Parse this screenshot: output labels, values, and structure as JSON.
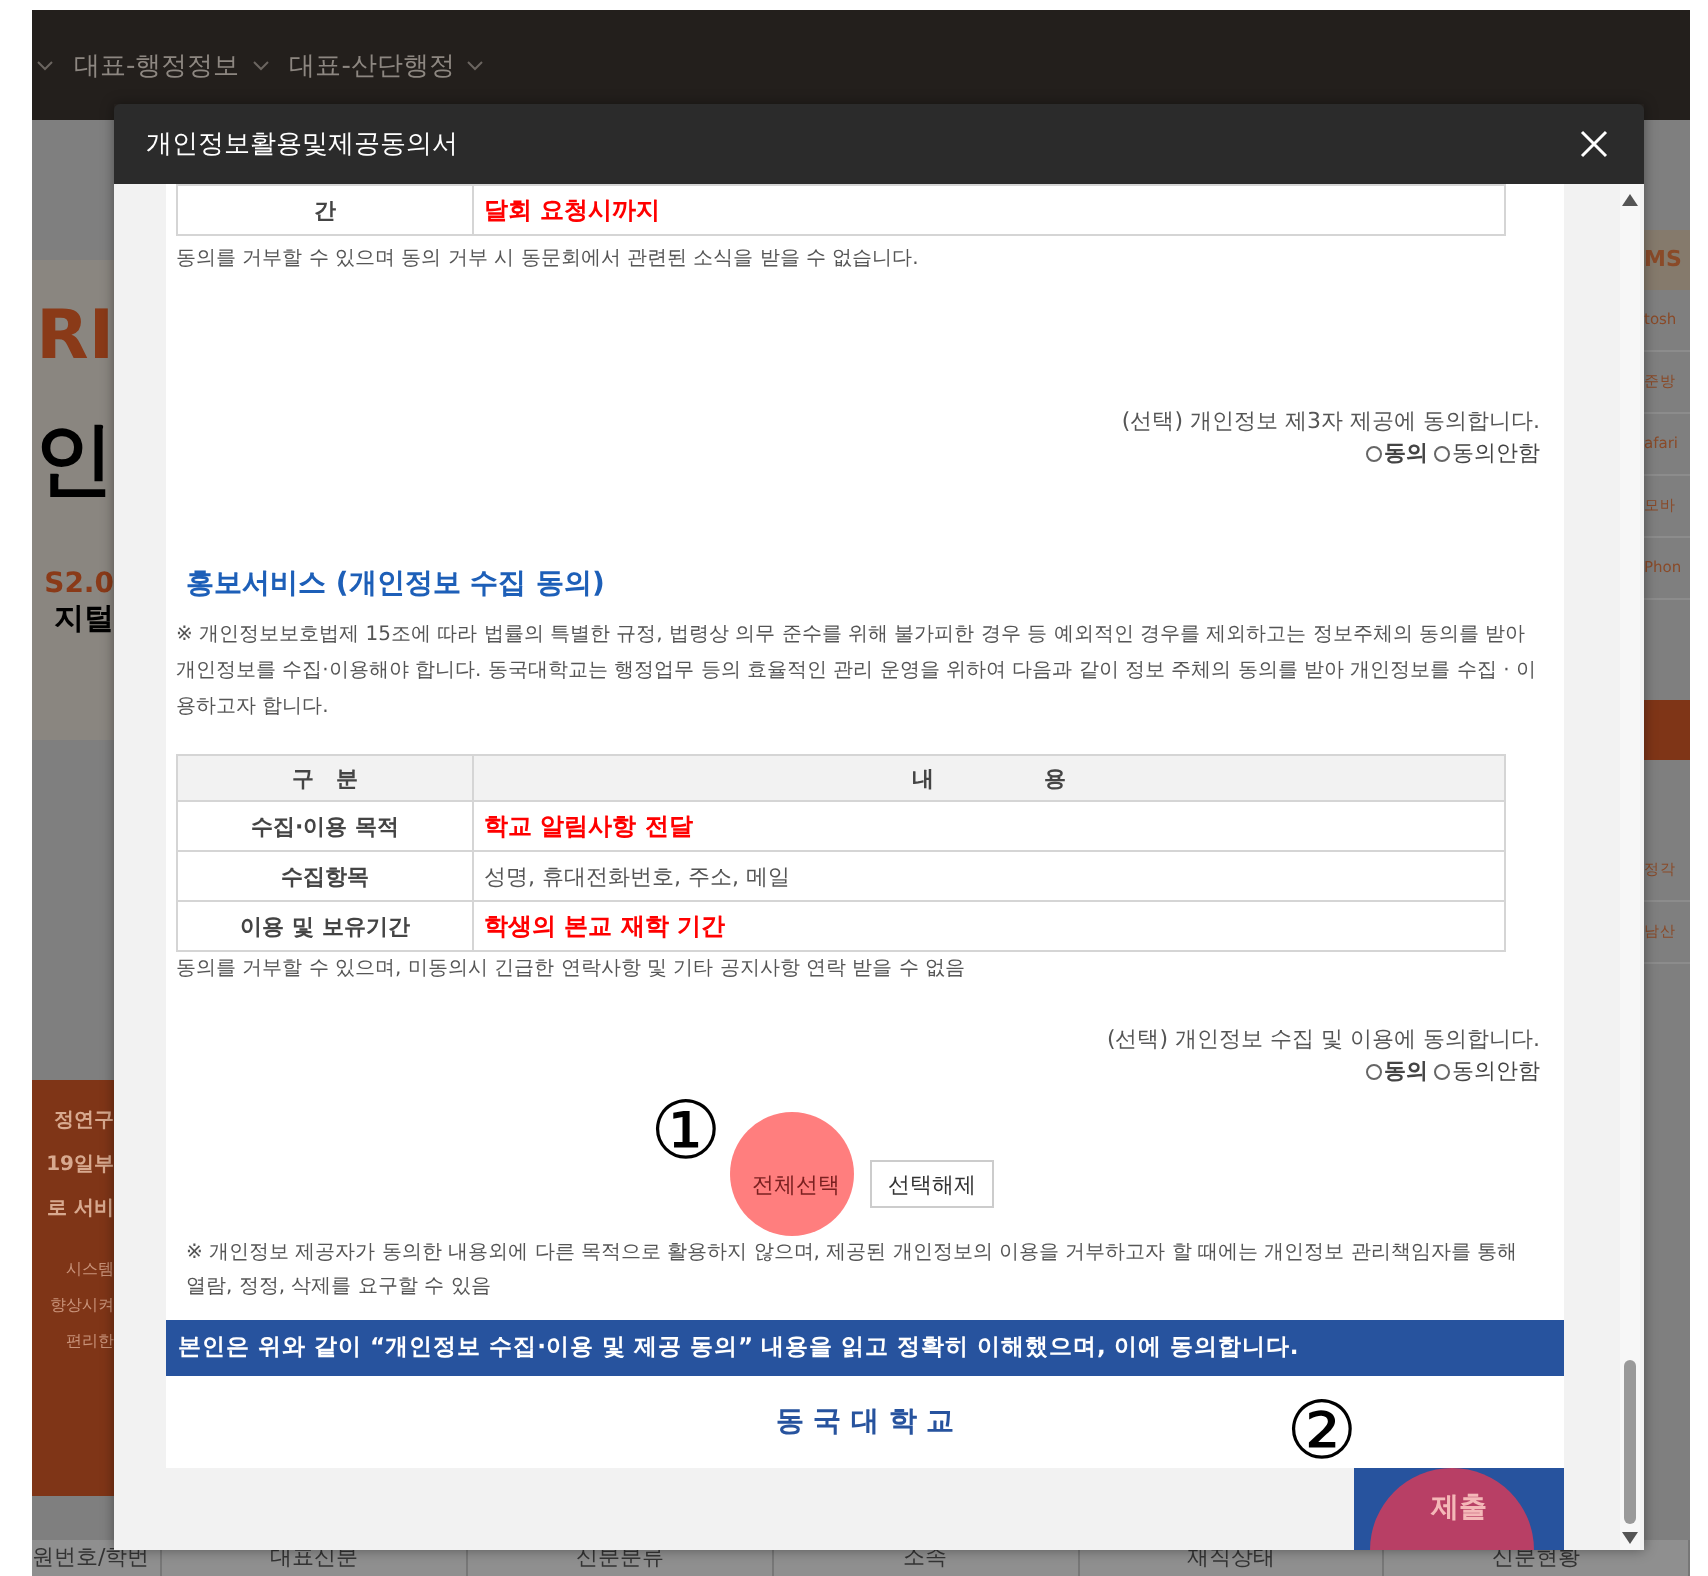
{
  "nav": {
    "items": [
      {
        "label": "대표-행정정보"
      },
      {
        "label": "대표-산단행정"
      }
    ]
  },
  "background": {
    "left": [
      {
        "text": "RI",
        "kind": "accent"
      },
      {
        "text": "인",
        "kind": "title"
      },
      {
        "text": "S2.0",
        "kind": "accent"
      },
      {
        "text": "지털",
        "kind": "strong"
      },
      {
        "text": "정연구",
        "kind": "notice"
      },
      {
        "text": "19일부",
        "kind": "notice"
      },
      {
        "text": "로 서비",
        "kind": "notice"
      },
      {
        "text": "시스템",
        "kind": "small"
      },
      {
        "text": "향상시켜",
        "kind": "small"
      },
      {
        "text": "편리한",
        "kind": "small"
      }
    ],
    "right": [
      {
        "text": "MS",
        "kind": "header"
      },
      {
        "text": "tosh",
        "kind": "row"
      },
      {
        "text": "준방",
        "kind": "row"
      },
      {
        "text": "afari",
        "kind": "row"
      },
      {
        "text": "모바",
        "kind": "row"
      },
      {
        "text": "Phon",
        "kind": "row"
      },
      {
        "kind": "band"
      },
      {
        "text": "정각",
        "kind": "row"
      },
      {
        "text": "남산",
        "kind": "row"
      }
    ],
    "bottom_columns": [
      "원번호/학번",
      "대표신분",
      "신분분류",
      "소속",
      "재직상태",
      "신분현황"
    ]
  },
  "dialog": {
    "title": "개인정보활용및제공동의서",
    "content": [
      {
        "kind": "table",
        "rows": [
          {
            "label": "간",
            "value": "달회 요청시까지",
            "emphasis": true
          }
        ]
      },
      {
        "kind": "note",
        "text": "동의를 거부할 수 있으며 동의 거부 시 동문회에서 관련된 소식을 받을 수 없습니다."
      },
      {
        "kind": "consent",
        "text": "(선택) 개인정보 제3자 제공에 동의합니다.",
        "options": [
          {
            "label": "동의",
            "selected": false
          },
          {
            "label": "동의안함",
            "selected": false
          }
        ]
      },
      {
        "kind": "heading",
        "text": "홍보서비스 (개인정보 수집 동의)"
      },
      {
        "kind": "paragraph",
        "text": "※ 개인정보보호법제 15조에 따라 법률의 특별한 규정, 법령상 의무 준수를 위해 불가피한 경우 등 예외적인 경우를 제외하고는 정보주체의 동의를 받아 개인정보를 수집·이용해야 합니다. 동국대학교는 행정업무 등의 효율적인 관리 운영을 위하여 다음과 같이 정보 주체의 동의를 받아 개인정보를 수집 · 이용하고자 합니다."
      },
      {
        "kind": "table",
        "columns": [
          "구　분",
          "내　　　　　용"
        ],
        "rows": [
          {
            "label": "수집·이용 목적",
            "value": "학교 알림사항 전달",
            "emphasis": true
          },
          {
            "label": "수집항목",
            "value": "성명, 휴대전화번호, 주소, 메일",
            "emphasis": false
          },
          {
            "label": "이용 및 보유기간",
            "value": "학생의 본교 재학 기간",
            "emphasis": true
          }
        ]
      },
      {
        "kind": "note",
        "text": "동의를 거부할 수 있으며, 미동의시 긴급한 연락사항 및 기타 공지사항 연락 받을 수 없음"
      },
      {
        "kind": "consent",
        "text": "(선택) 개인정보 수집 및 이용에 동의합니다.",
        "options": [
          {
            "label": "동의",
            "selected": false
          },
          {
            "label": "동의안함",
            "selected": false
          }
        ]
      },
      {
        "kind": "buttons",
        "marker": "①",
        "buttons": [
          {
            "label": "전체선택",
            "highlighted": true
          },
          {
            "label": "선택해제",
            "highlighted": false
          }
        ]
      },
      {
        "kind": "paragraph",
        "text": "※ 개인정보 제공자가 동의한 내용외에 다른 목적으로 활용하지 않으며, 제공된 개인정보의 이용을 거부하고자 할 때에는 개인정보 관리책임자를 통해 열람, 정정, 삭제를 요구할 수 있음"
      },
      {
        "kind": "banner",
        "text": "본인은 위와 같이 “개인정보 수집·이용 및 제공 동의” 내용을 읽고 정확히 이해했으며, 이에 동의합니다."
      },
      {
        "kind": "signature",
        "text": "동 국 대 학 교",
        "marker": "②"
      },
      {
        "kind": "submit",
        "label": "제출",
        "highlighted": true
      }
    ]
  }
}
